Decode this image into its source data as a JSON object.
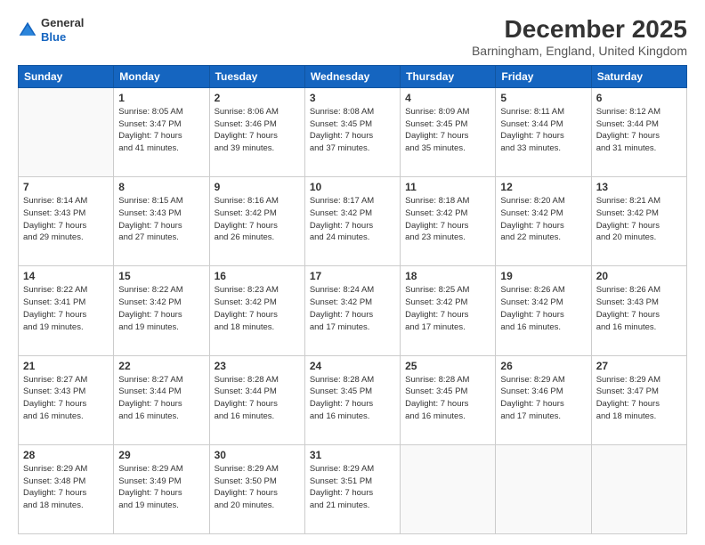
{
  "header": {
    "logo_line1": "General",
    "logo_line2": "Blue",
    "month_title": "December 2025",
    "location": "Barningham, England, United Kingdom"
  },
  "weekdays": [
    "Sunday",
    "Monday",
    "Tuesday",
    "Wednesday",
    "Thursday",
    "Friday",
    "Saturday"
  ],
  "weeks": [
    [
      {
        "day": "",
        "info": ""
      },
      {
        "day": "1",
        "info": "Sunrise: 8:05 AM\nSunset: 3:47 PM\nDaylight: 7 hours\nand 41 minutes."
      },
      {
        "day": "2",
        "info": "Sunrise: 8:06 AM\nSunset: 3:46 PM\nDaylight: 7 hours\nand 39 minutes."
      },
      {
        "day": "3",
        "info": "Sunrise: 8:08 AM\nSunset: 3:45 PM\nDaylight: 7 hours\nand 37 minutes."
      },
      {
        "day": "4",
        "info": "Sunrise: 8:09 AM\nSunset: 3:45 PM\nDaylight: 7 hours\nand 35 minutes."
      },
      {
        "day": "5",
        "info": "Sunrise: 8:11 AM\nSunset: 3:44 PM\nDaylight: 7 hours\nand 33 minutes."
      },
      {
        "day": "6",
        "info": "Sunrise: 8:12 AM\nSunset: 3:44 PM\nDaylight: 7 hours\nand 31 minutes."
      }
    ],
    [
      {
        "day": "7",
        "info": "Sunrise: 8:14 AM\nSunset: 3:43 PM\nDaylight: 7 hours\nand 29 minutes."
      },
      {
        "day": "8",
        "info": "Sunrise: 8:15 AM\nSunset: 3:43 PM\nDaylight: 7 hours\nand 27 minutes."
      },
      {
        "day": "9",
        "info": "Sunrise: 8:16 AM\nSunset: 3:42 PM\nDaylight: 7 hours\nand 26 minutes."
      },
      {
        "day": "10",
        "info": "Sunrise: 8:17 AM\nSunset: 3:42 PM\nDaylight: 7 hours\nand 24 minutes."
      },
      {
        "day": "11",
        "info": "Sunrise: 8:18 AM\nSunset: 3:42 PM\nDaylight: 7 hours\nand 23 minutes."
      },
      {
        "day": "12",
        "info": "Sunrise: 8:20 AM\nSunset: 3:42 PM\nDaylight: 7 hours\nand 22 minutes."
      },
      {
        "day": "13",
        "info": "Sunrise: 8:21 AM\nSunset: 3:42 PM\nDaylight: 7 hours\nand 20 minutes."
      }
    ],
    [
      {
        "day": "14",
        "info": "Sunrise: 8:22 AM\nSunset: 3:41 PM\nDaylight: 7 hours\nand 19 minutes."
      },
      {
        "day": "15",
        "info": "Sunrise: 8:22 AM\nSunset: 3:42 PM\nDaylight: 7 hours\nand 19 minutes."
      },
      {
        "day": "16",
        "info": "Sunrise: 8:23 AM\nSunset: 3:42 PM\nDaylight: 7 hours\nand 18 minutes."
      },
      {
        "day": "17",
        "info": "Sunrise: 8:24 AM\nSunset: 3:42 PM\nDaylight: 7 hours\nand 17 minutes."
      },
      {
        "day": "18",
        "info": "Sunrise: 8:25 AM\nSunset: 3:42 PM\nDaylight: 7 hours\nand 17 minutes."
      },
      {
        "day": "19",
        "info": "Sunrise: 8:26 AM\nSunset: 3:42 PM\nDaylight: 7 hours\nand 16 minutes."
      },
      {
        "day": "20",
        "info": "Sunrise: 8:26 AM\nSunset: 3:43 PM\nDaylight: 7 hours\nand 16 minutes."
      }
    ],
    [
      {
        "day": "21",
        "info": "Sunrise: 8:27 AM\nSunset: 3:43 PM\nDaylight: 7 hours\nand 16 minutes."
      },
      {
        "day": "22",
        "info": "Sunrise: 8:27 AM\nSunset: 3:44 PM\nDaylight: 7 hours\nand 16 minutes."
      },
      {
        "day": "23",
        "info": "Sunrise: 8:28 AM\nSunset: 3:44 PM\nDaylight: 7 hours\nand 16 minutes."
      },
      {
        "day": "24",
        "info": "Sunrise: 8:28 AM\nSunset: 3:45 PM\nDaylight: 7 hours\nand 16 minutes."
      },
      {
        "day": "25",
        "info": "Sunrise: 8:28 AM\nSunset: 3:45 PM\nDaylight: 7 hours\nand 16 minutes."
      },
      {
        "day": "26",
        "info": "Sunrise: 8:29 AM\nSunset: 3:46 PM\nDaylight: 7 hours\nand 17 minutes."
      },
      {
        "day": "27",
        "info": "Sunrise: 8:29 AM\nSunset: 3:47 PM\nDaylight: 7 hours\nand 18 minutes."
      }
    ],
    [
      {
        "day": "28",
        "info": "Sunrise: 8:29 AM\nSunset: 3:48 PM\nDaylight: 7 hours\nand 18 minutes."
      },
      {
        "day": "29",
        "info": "Sunrise: 8:29 AM\nSunset: 3:49 PM\nDaylight: 7 hours\nand 19 minutes."
      },
      {
        "day": "30",
        "info": "Sunrise: 8:29 AM\nSunset: 3:50 PM\nDaylight: 7 hours\nand 20 minutes."
      },
      {
        "day": "31",
        "info": "Sunrise: 8:29 AM\nSunset: 3:51 PM\nDaylight: 7 hours\nand 21 minutes."
      },
      {
        "day": "",
        "info": ""
      },
      {
        "day": "",
        "info": ""
      },
      {
        "day": "",
        "info": ""
      }
    ]
  ]
}
